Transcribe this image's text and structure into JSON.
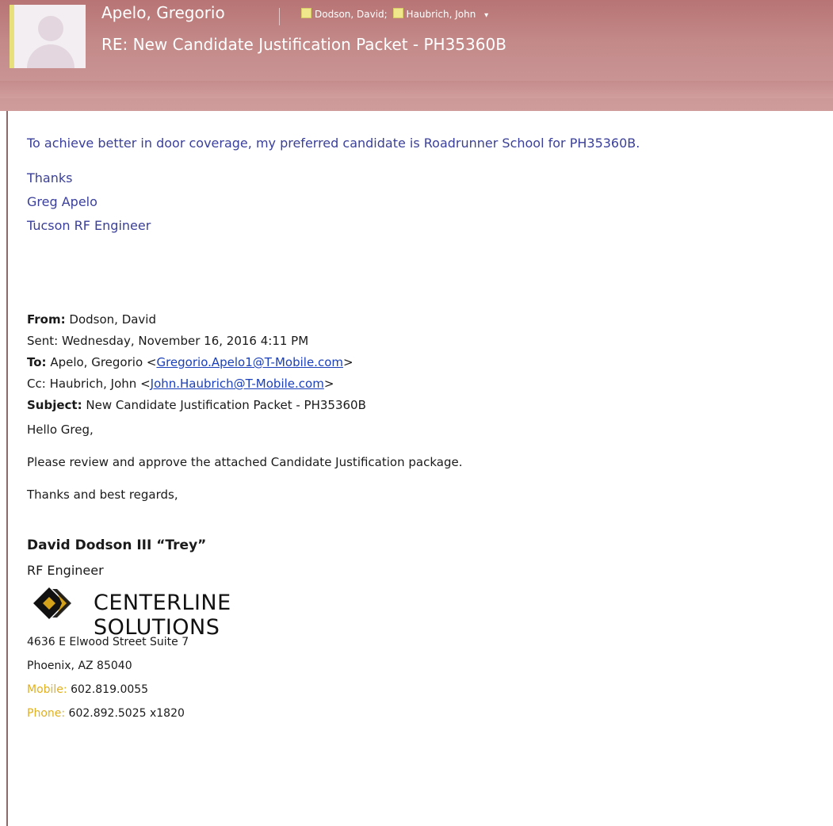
{
  "header": {
    "sender": "Apelo, Gregorio",
    "recipients": [
      "Dodson, David;",
      "Haubrich, John"
    ],
    "subject": "RE: New Candidate Justification Packet - PH35360B"
  },
  "reply": {
    "text": "To achieve better in door coverage, my  preferred candidate is Roadrunner School for PH35360B.",
    "signature": [
      "Thanks",
      "Greg Apelo",
      "Tucson RF Engineer"
    ]
  },
  "original": {
    "from_label": "From:",
    "from_value": "Dodson, David",
    "sent_label": "Sent:",
    "sent_value": "Wednesday, November 16, 2016 4:11 PM",
    "to_label": "To:",
    "to_name": "Apelo, Gregorio <",
    "to_email": "Gregorio.Apelo1@T-Mobile.com",
    "to_close": ">",
    "cc_label": "Cc:",
    "cc_name": "Haubrich, John <",
    "cc_email": "John.Haubrich@T-Mobile.com",
    "cc_close": ">",
    "subject_label": "Subject:",
    "subject_value": "New Candidate Justification Packet - PH35360B",
    "greeting": "Hello Greg,",
    "body": "Please review and approve the attached Candidate Justification package.",
    "closing": "Thanks and best regards,"
  },
  "signature": {
    "name": "David Dodson III “Trey”",
    "title": "RF Engineer",
    "company": "CENTERLINE SOLUTIONS",
    "address_1": "4636 E Elwood Street Suite 7",
    "address_2": "Phoenix, AZ  85040",
    "mobile_label": "Mobile:",
    "mobile": "602.819.0055",
    "phone_label": "Phone:",
    "phone": "602.892.5025 x1820"
  },
  "colors": {
    "header_bg": "#c48a8a",
    "reply_text": "#3a3f9a",
    "link": "#1a3fb8",
    "contact_label": "#e0b020"
  },
  "icons": [
    "contact-avatar-icon",
    "contact-status-icon",
    "chevron-down-icon",
    "company-logo-icon"
  ]
}
